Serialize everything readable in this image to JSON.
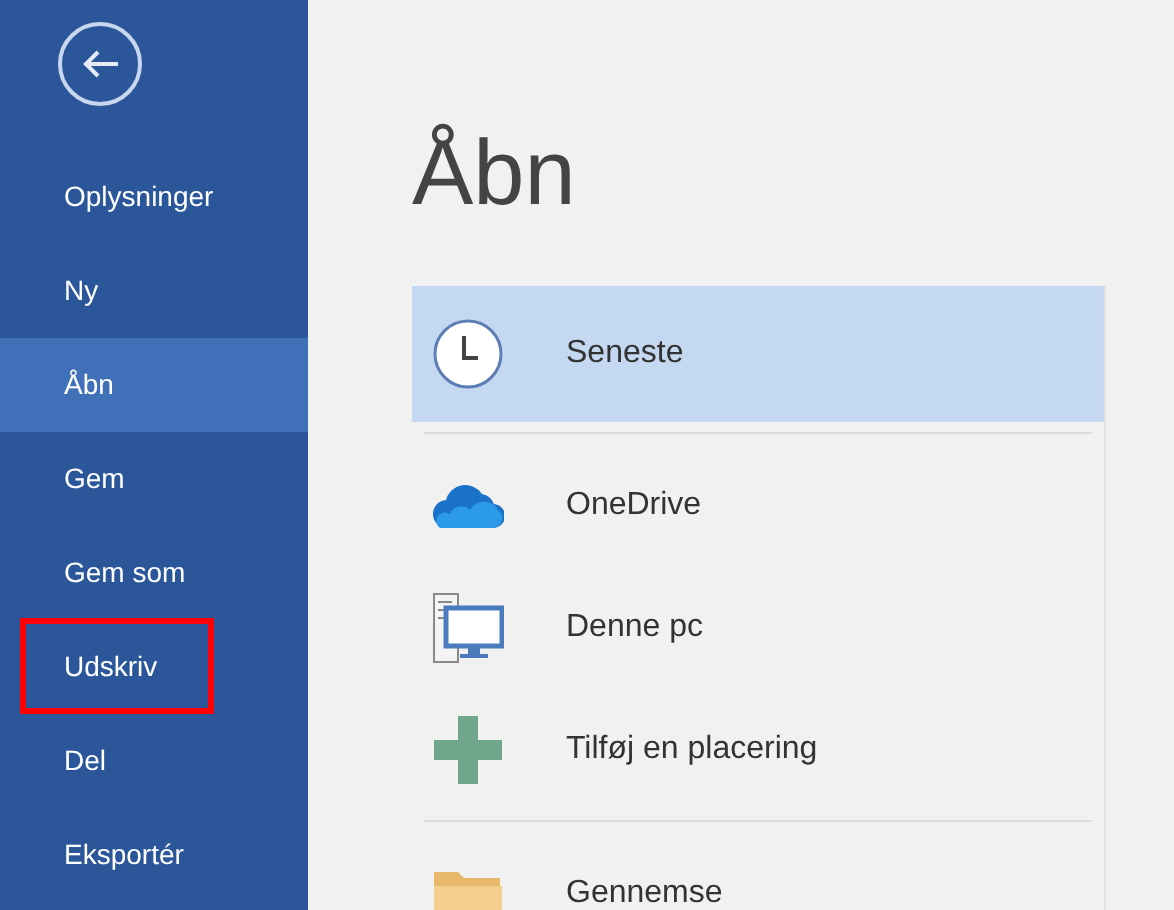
{
  "sidebar": {
    "items": [
      {
        "label": "Oplysninger",
        "selected": false,
        "highlighted": false
      },
      {
        "label": "Ny",
        "selected": false,
        "highlighted": false
      },
      {
        "label": "Åbn",
        "selected": true,
        "highlighted": false
      },
      {
        "label": "Gem",
        "selected": false,
        "highlighted": false
      },
      {
        "label": "Gem som",
        "selected": false,
        "highlighted": false
      },
      {
        "label": "Udskriv",
        "selected": false,
        "highlighted": true
      },
      {
        "label": "Del",
        "selected": false,
        "highlighted": false
      },
      {
        "label": "Eksportér",
        "selected": false,
        "highlighted": false
      }
    ]
  },
  "page": {
    "title": "Åbn"
  },
  "locations": {
    "groups": [
      {
        "items": [
          {
            "label": "Seneste",
            "kind": "clock",
            "selected": true
          }
        ]
      },
      {
        "items": [
          {
            "label": "OneDrive",
            "kind": "cloud",
            "selected": false
          },
          {
            "label": "Denne pc",
            "kind": "pc",
            "selected": false
          },
          {
            "label": "Tilføj en placering",
            "kind": "plus",
            "selected": false
          }
        ]
      },
      {
        "items": [
          {
            "label": "Gennemse",
            "kind": "folder",
            "selected": false
          }
        ]
      }
    ]
  }
}
